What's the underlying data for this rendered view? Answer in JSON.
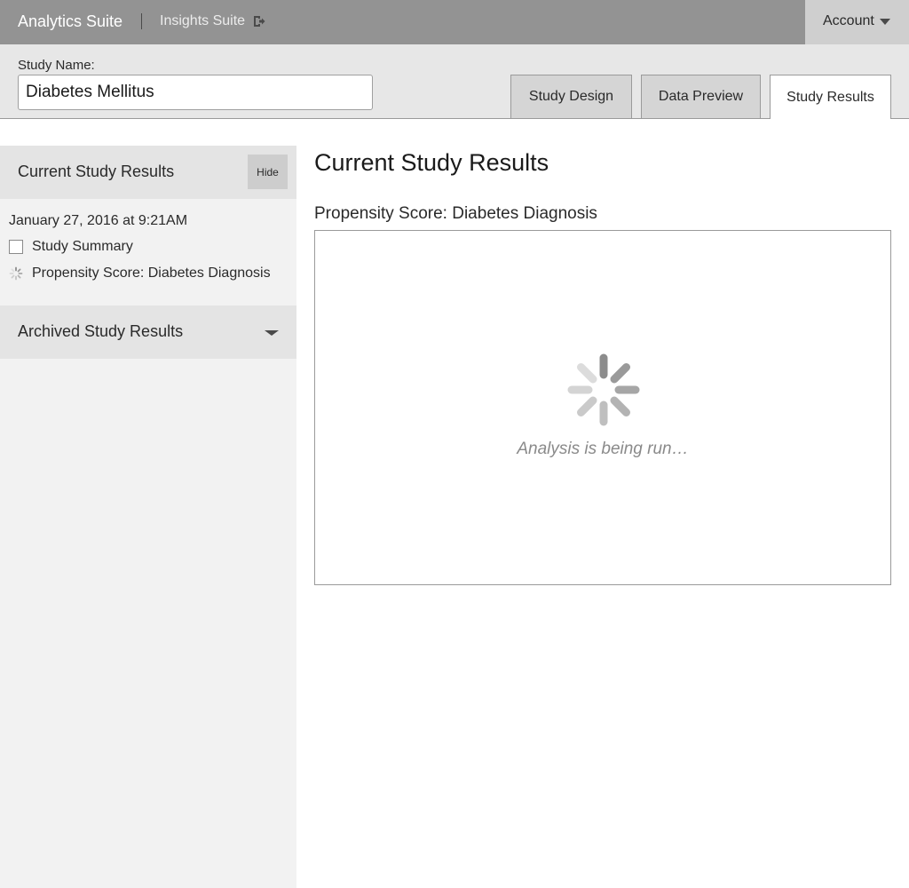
{
  "topbar": {
    "app_title": "Analytics Suite",
    "suite_link_label": "Insights Suite",
    "suite_link_icon": "exit-icon",
    "account_label": "Account"
  },
  "study": {
    "label": "Study Name:",
    "name_value": "Diabetes Mellitus"
  },
  "tabs": [
    {
      "label": "Study Design",
      "active": false
    },
    {
      "label": "Data Preview",
      "active": false
    },
    {
      "label": "Study Results",
      "active": true
    }
  ],
  "sidebar": {
    "current": {
      "title": "Current Study Results",
      "hide_label": "Hide",
      "run_date": "January 27, 2016 at 9:21AM",
      "items": [
        {
          "label": "Study Summary",
          "status": "checkbox"
        },
        {
          "label": "Propensity Score: Diabetes Diagnosis",
          "status": "loading"
        }
      ]
    },
    "archived": {
      "title": "Archived Study Results",
      "expanded": false
    }
  },
  "main": {
    "title": "Current Study Results",
    "result": {
      "title": "Propensity Score: Diabetes Diagnosis",
      "loading_text": "Analysis is being run…"
    }
  },
  "colors": {
    "topbar_bg": "#939393",
    "account_bg": "#cfcfcf",
    "header_bg": "#e7e7e7",
    "sidebar_bg": "#f2f2f2",
    "panel_bg": "#e4e4e4",
    "loading_text": "#8a8a8a"
  }
}
